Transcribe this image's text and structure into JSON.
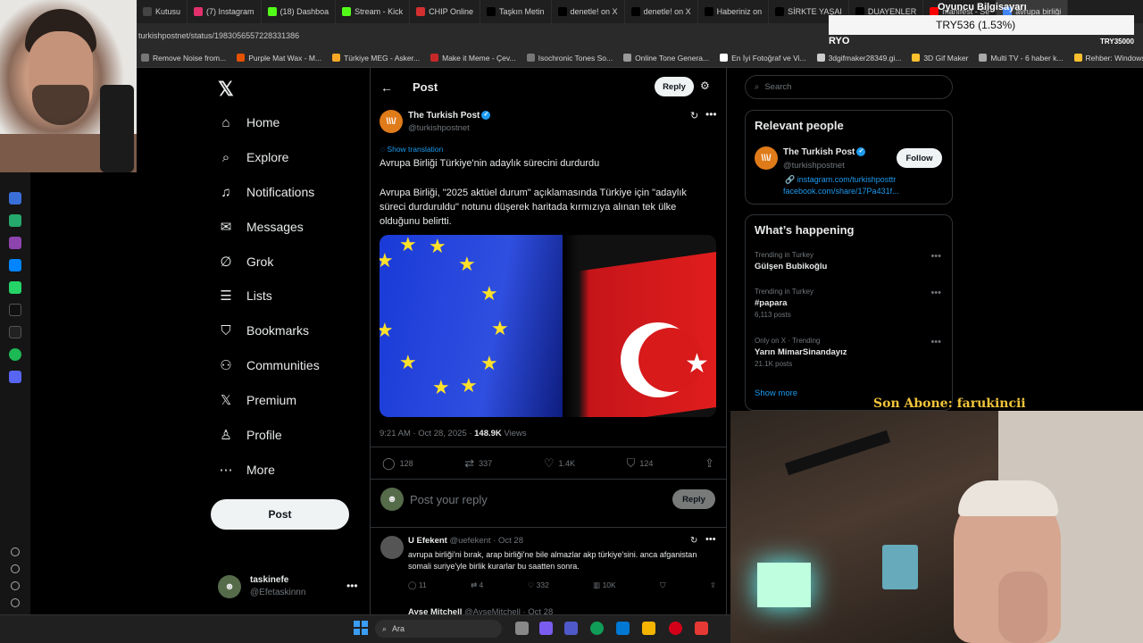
{
  "browser": {
    "tabs": [
      {
        "label": "Kutusu",
        "color": "#444"
      },
      {
        "label": "(7) Instagram",
        "color": "#e1306c"
      },
      {
        "label": "(18) Dashboa",
        "color": "#53fc18"
      },
      {
        "label": "Stream - Kick",
        "color": "#53fc18"
      },
      {
        "label": "CHIP Online",
        "color": "#d32f2f"
      },
      {
        "label": "Taşkın Metin",
        "color": "#000"
      },
      {
        "label": "denetle! on X",
        "color": "#000"
      },
      {
        "label": "denetle! on X",
        "color": "#000"
      },
      {
        "label": "Haberiniz on",
        "color": "#000"
      },
      {
        "label": "SİRKTE YAŞAI",
        "color": "#000"
      },
      {
        "label": "DUAYENLER",
        "color": "#000"
      },
      {
        "label": "manifest - Se",
        "color": "#ff0000"
      },
      {
        "label": "avrupa birliği",
        "color": "#4285f4"
      }
    ],
    "url": "turkishpostnet/status/1983056557228331386",
    "bookmarks": [
      {
        "label": "Remove Noise from...",
        "color": "#777"
      },
      {
        "label": "Purple Mat Wax - M...",
        "color": "#e65100"
      },
      {
        "label": "Türkiye MEG - Asker...",
        "color": "#f9a825"
      },
      {
        "label": "Make it Meme - Çev...",
        "color": "#c62828"
      },
      {
        "label": "Isochronic Tones So...",
        "color": "#777"
      },
      {
        "label": "Online Tone Genera...",
        "color": "#999"
      },
      {
        "label": "En İyi Fotoğraf ve Vi...",
        "color": "#fff"
      },
      {
        "label": "3dgifmaker28349.gi...",
        "color": "#ccc"
      },
      {
        "label": "3D Gif Maker",
        "color": "#fbc02d"
      },
      {
        "label": "Multi TV - 6 haber k...",
        "color": "#aaa"
      },
      {
        "label": "Rehber: Windows 1...",
        "color": "#fbc02d"
      }
    ]
  },
  "overlay": {
    "ticker_text": "TRY536 (1.53%)",
    "ryo_label": "RYO",
    "right_label": "TRY35000",
    "title_label": "Oyuncu Bilgisayarı",
    "subscriber_banner": "Son Abone: farukincii"
  },
  "nav": {
    "items": [
      {
        "label": "Home",
        "icon": "home-icon",
        "glyph": "⌂"
      },
      {
        "label": "Explore",
        "icon": "search-icon",
        "glyph": "⌕"
      },
      {
        "label": "Notifications",
        "icon": "bell-icon",
        "glyph": "♫"
      },
      {
        "label": "Messages",
        "icon": "mail-icon",
        "glyph": "✉"
      },
      {
        "label": "Grok",
        "icon": "grok-icon",
        "glyph": "∅"
      },
      {
        "label": "Lists",
        "icon": "list-icon",
        "glyph": "☰"
      },
      {
        "label": "Bookmarks",
        "icon": "bookmark-icon",
        "glyph": "⛉"
      },
      {
        "label": "Communities",
        "icon": "communities-icon",
        "glyph": "⚇"
      },
      {
        "label": "Premium",
        "icon": "x-premium-icon",
        "glyph": "𝕏"
      },
      {
        "label": "Profile",
        "icon": "person-icon",
        "glyph": "♙"
      },
      {
        "label": "More",
        "icon": "more-circle-icon",
        "glyph": "⋯"
      }
    ],
    "post_label": "Post",
    "account_name": "taskinefe",
    "account_handle": "@Efetaskinnn"
  },
  "post": {
    "header_title": "Post",
    "reply_label": "Reply",
    "author_name": "The Turkish Post",
    "author_handle": "@turkishpostnet",
    "avatar_text": "\\\\\\/",
    "show_translation": "Show translation",
    "headline": "Avrupa Birliği Türkiye'nin adaylık sürecini durdurdu",
    "body": "Avrupa Birliği, \"2025 aktüel durum\" açıklamasında Türkiye için \"adaylık süreci durduruldu\" notunu düşerek haritada kırmızıya alınan tek ülke olduğunu belirtti.",
    "time": "9:21 AM · Oct 28, 2025 ·",
    "views": "148.9K",
    "views_label": "Views",
    "stats": {
      "replies": "128",
      "reposts": "337",
      "likes": "1.4K",
      "bookmarks": "124"
    },
    "reply_placeholder": "Post your reply",
    "reply_button": "Reply"
  },
  "replies": [
    {
      "name": "U Efekent",
      "handle": "@uefekent",
      "date": "· Oct 28",
      "text": "avrupa birliği'ni bırak, arap birliği'ne bile almazlar akp türkiye'sini. anca afganistan somali suriye'yle birlik kurarlar bu saatten sonra.",
      "replies": "11",
      "reposts": "4",
      "likes": "332",
      "views": "10K"
    },
    {
      "name": "Ayse Mitchell",
      "handle": "@AyseMitchell",
      "date": "· Oct 28"
    }
  ],
  "sidebar": {
    "search_placeholder": "Search",
    "relevant_title": "Relevant people",
    "person_name": "The Turkish Post",
    "person_handle": "@turkishpostnet",
    "follow_label": "Follow",
    "link1": "instagram.com/turkishposttr",
    "link2": "facebook.com/share/17Pa431f...",
    "happening_title": "What’s happening",
    "trends": [
      {
        "context": "Trending in Turkey",
        "title": "Gülşen Bubikoğlu",
        "count": ""
      },
      {
        "context": "Trending in Turkey",
        "title": "#papara",
        "count": "6,113 posts"
      },
      {
        "context": "Only on X · Trending",
        "title": "Yarın MimarSinandayız",
        "count": "21.1K posts"
      }
    ],
    "show_more": "Show more"
  },
  "taskbar": {
    "search_label": "Ara"
  },
  "colors": {
    "accent": "#1d9bf0",
    "background": "#000000",
    "border": "#2f3336"
  }
}
